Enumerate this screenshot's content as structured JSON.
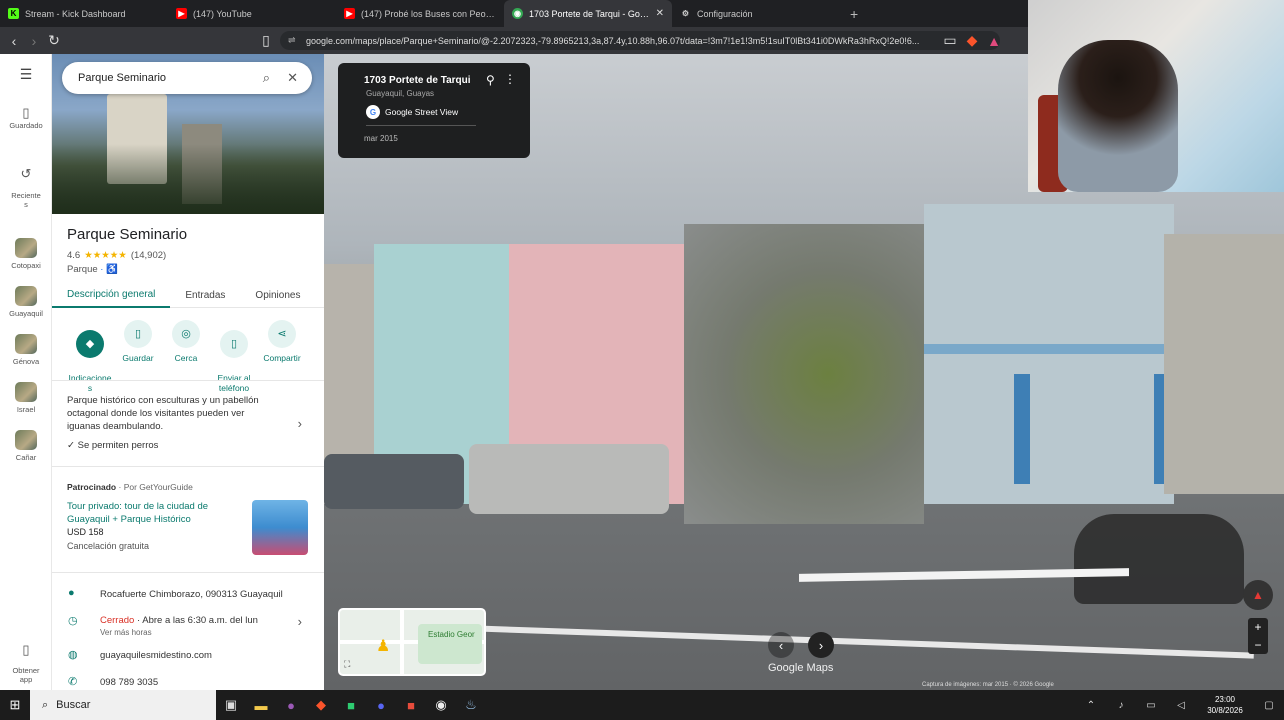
{
  "browser": {
    "tabs": [
      {
        "title": "Stream - Kick Dashboard",
        "favicon": "kick-icon",
        "color": "#53fc18"
      },
      {
        "title": "(147) YouTube",
        "favicon": "youtube-icon",
        "color": "#ff0000"
      },
      {
        "title": "(147) Probé los Buses con Peores Re",
        "favicon": "youtube-icon",
        "color": "#ff0000"
      },
      {
        "title": "1703 Portete de Tarqui - Google",
        "favicon": "maps-icon",
        "color": "#34a853"
      },
      {
        "title": "Configuración",
        "favicon": "gear-icon",
        "color": "#aaaaaa"
      }
    ],
    "url": "google.com/maps/place/Parque+Seminario/@-2.2072323,-79.8965213,3a,87.4y,10.88h,96.07t/data=!3m7!1e1!3m5!1suIT0lBt341i0DWkRa3hRxQ!2e0!6..."
  },
  "rail": {
    "items": [
      {
        "label": "Guardado",
        "icon": "bookmark-icon"
      },
      {
        "label": "Reciente\ns",
        "icon": "history-icon"
      },
      {
        "label": "Cotopaxi",
        "icon": "place-thumb"
      },
      {
        "label": "Guayaquil",
        "icon": "place-thumb"
      },
      {
        "label": "Génova",
        "icon": "place-thumb"
      },
      {
        "label": "Israel",
        "icon": "place-thumb"
      },
      {
        "label": "Cañar",
        "icon": "place-thumb"
      },
      {
        "label": "Obtener\napp",
        "icon": "phone-icon"
      }
    ]
  },
  "search": {
    "value": "Parque Seminario"
  },
  "place": {
    "title": "Parque Seminario",
    "rating": "4.6",
    "stars": "★★★★★",
    "reviews": "(14,902)",
    "category": "Parque",
    "tabs": [
      "Descripción general",
      "Entradas",
      "Opiniones"
    ],
    "actions": [
      {
        "label": "Indicacione\ns"
      },
      {
        "label": "Guardar"
      },
      {
        "label": "Cerca"
      },
      {
        "label": "Enviar al\nteléfono"
      },
      {
        "label": "Compartir"
      }
    ],
    "description": "Parque histórico con esculturas y un pabellón octagonal donde los visitantes pueden ver iguanas deambulando.",
    "pets": "Se permiten perros",
    "sponsored": {
      "label": "Patrocinado",
      "by": "· Por GetYourGuide",
      "title": "Tour privado: tour de la ciudad de Guayaquil + Parque Histórico",
      "price": "USD 158",
      "cancel": "Cancelación gratuita"
    },
    "address": "Rocafuerte Chimborazo, 090313 Guayaquil",
    "hours_status": "Cerrado",
    "hours_open": "· Abre a las 6:30 a.m. del lun",
    "hours_more": "Ver más horas",
    "website": "guayaquilesmidestino.com",
    "phone": "098 789 3035"
  },
  "streetview": {
    "title": "1703 Portete de Tarqui",
    "subtitle": "Guayaquil, Guayas",
    "source": "Google Street View",
    "date": "mar 2015",
    "watermark": "Google Maps",
    "attribution": "Captura de imágenes: mar 2015 · © 2026 Google",
    "minimap_label": "Estadio Geor"
  },
  "taskbar": {
    "search_placeholder": "Buscar",
    "time": "23:00",
    "date": "30/8/2026"
  }
}
